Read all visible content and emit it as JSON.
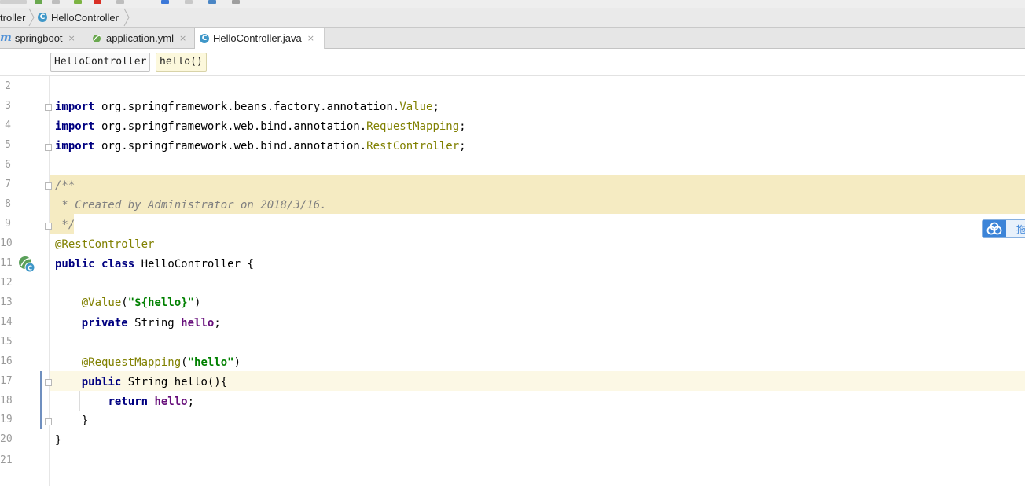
{
  "breadcrumb": {
    "items": [
      {
        "label": "troller"
      },
      {
        "label": "HelloController",
        "icon": "class-icon"
      }
    ]
  },
  "tabs": [
    {
      "label": "springboot",
      "icon": "maven-module-icon",
      "close": "×",
      "active": false
    },
    {
      "label": "application.yml",
      "icon": "spring-yml-icon",
      "close": "×",
      "active": false
    },
    {
      "label": "HelloController.java",
      "icon": "class-icon",
      "close": "×",
      "active": true
    }
  ],
  "structure_crumbs": [
    {
      "label": "HelloController",
      "active": false
    },
    {
      "label": "hello()",
      "active": true
    }
  ],
  "editor": {
    "line_numbers": [
      "2",
      "3",
      "4",
      "5",
      "6",
      "7",
      "8",
      "9",
      "10",
      "11",
      "12",
      "13",
      "14",
      "15",
      "16",
      "17",
      "18",
      "19",
      "20",
      "21"
    ],
    "current_line": "17",
    "code": {
      "l3": {
        "kw": "import",
        "pkg": " org.springframework.beans.factory.annotation.",
        "cls": "Value",
        "semi": ";"
      },
      "l4": {
        "kw": "import",
        "pkg": " org.springframework.web.bind.annotation.",
        "cls": "RequestMapping",
        "semi": ";"
      },
      "l5": {
        "kw": "import",
        "pkg": " org.springframework.web.bind.annotation.",
        "cls": "RestController",
        "semi": ";"
      },
      "l7": "/**",
      "l8": " * Created by Administrator on 2018/3/16.",
      "l9": " */",
      "l10": "@RestController",
      "l11": {
        "kw1": "public",
        "kw2": "class",
        "rest": " HelloController {"
      },
      "l13": {
        "ann": "@Value",
        "open": "(",
        "str": "\"${hello}\"",
        "close": ")"
      },
      "l14": {
        "kw": "private",
        "type": " String ",
        "fld": "hello",
        "semi": ";"
      },
      "l16": {
        "ann": "@RequestMapping",
        "open": "(",
        "str": "\"hello\"",
        "close": ")"
      },
      "l17": {
        "kw": "public",
        "rest": " String hello(){"
      },
      "l18": {
        "kw": "return",
        "fld": "hello",
        "semi": ";"
      },
      "l19": "}",
      "l20": "}"
    }
  },
  "floating_widget": {
    "text": "拖",
    "icon": "baidu-cloud-icon"
  },
  "colors": {
    "keyword": "#000080",
    "annotation": "#808000",
    "comment": "#808080",
    "string": "#008000",
    "field": "#660e7a",
    "doc_highlight": "#f5ebc2",
    "caret_row": "#fcf8e5"
  }
}
